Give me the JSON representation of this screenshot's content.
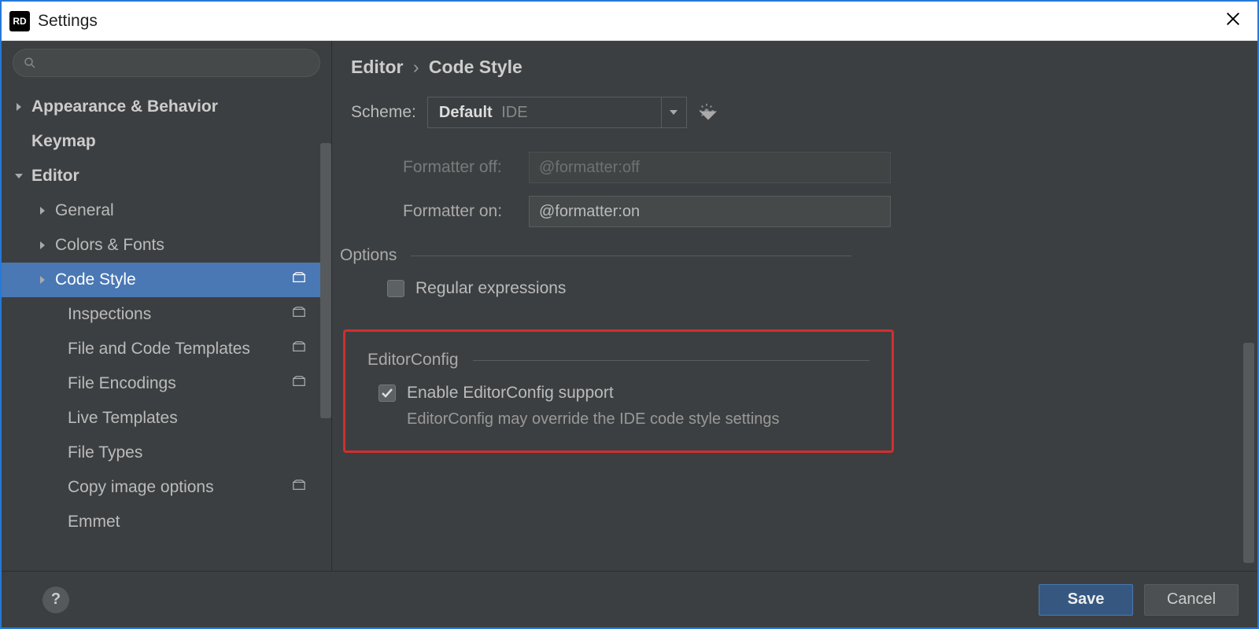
{
  "window": {
    "title": "Settings",
    "logo_text": "RD"
  },
  "search": {
    "placeholder": ""
  },
  "tree": {
    "items": [
      {
        "label": "Appearance & Behavior",
        "bold": true,
        "arrow": "right",
        "indent": 0
      },
      {
        "label": "Keymap",
        "bold": true,
        "arrow": "",
        "indent": 0
      },
      {
        "label": "Editor",
        "bold": true,
        "arrow": "down",
        "indent": 0
      },
      {
        "label": "General",
        "arrow": "right",
        "indent": 1
      },
      {
        "label": "Colors & Fonts",
        "arrow": "right",
        "indent": 1
      },
      {
        "label": "Code Style",
        "arrow": "right",
        "indent": 1,
        "selected": true,
        "badge": true
      },
      {
        "label": "Inspections",
        "indent": 2,
        "badge": true
      },
      {
        "label": "File and Code Templates",
        "indent": 2,
        "badge": true
      },
      {
        "label": "File Encodings",
        "indent": 2,
        "badge": true
      },
      {
        "label": "Live Templates",
        "indent": 2
      },
      {
        "label": "File Types",
        "indent": 2
      },
      {
        "label": "Copy image options",
        "indent": 2,
        "badge": true
      },
      {
        "label": "Emmet",
        "indent": 2
      }
    ]
  },
  "breadcrumb": {
    "part1": "Editor",
    "part2": "Code Style"
  },
  "scheme": {
    "label": "Scheme:",
    "value": "Default",
    "suffix": "IDE"
  },
  "formatter": {
    "off_label": "Formatter off:",
    "off_value": "@formatter:off",
    "on_label": "Formatter on:",
    "on_value": "@formatter:on"
  },
  "options": {
    "header": "Options",
    "regex_label": "Regular expressions",
    "regex_checked": false
  },
  "editorconfig": {
    "header": "EditorConfig",
    "enable_label": "Enable EditorConfig support",
    "enable_checked": true,
    "note": "EditorConfig may override the IDE code style settings"
  },
  "footer": {
    "save": "Save",
    "cancel": "Cancel",
    "help": "?"
  }
}
